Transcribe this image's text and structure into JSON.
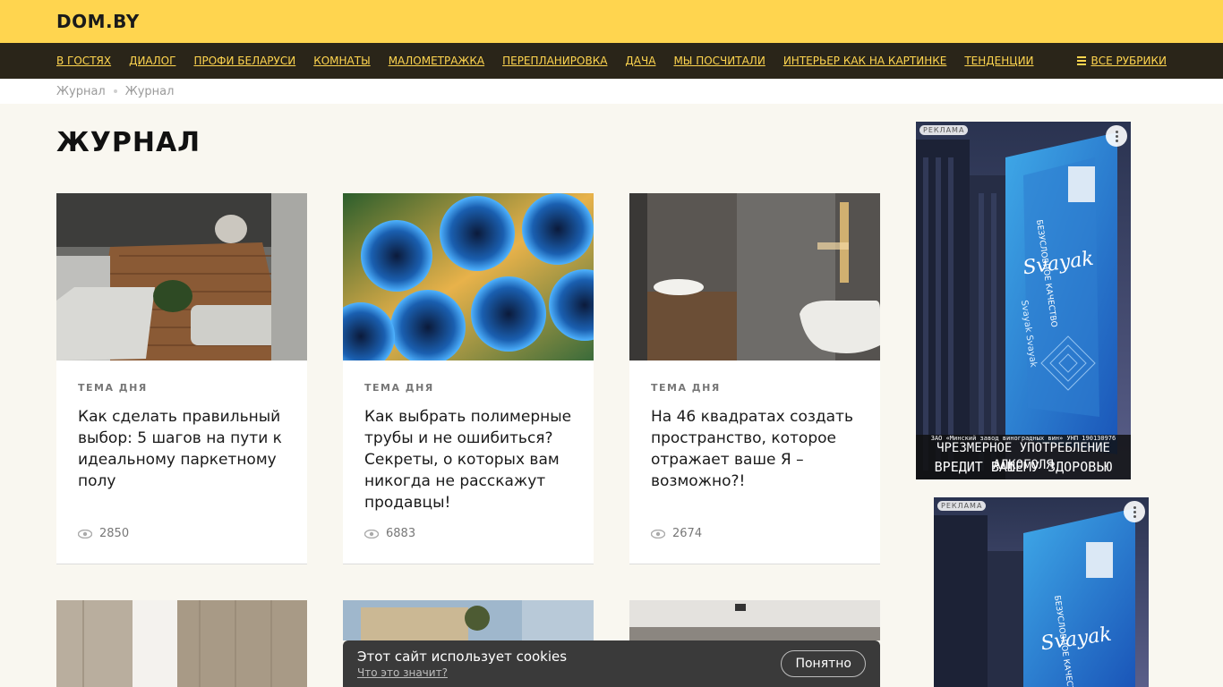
{
  "header": {
    "logo": "DOM.BY"
  },
  "nav": {
    "items": [
      "В ГОСТЯХ",
      "ДИАЛОГ",
      "ПРОФИ БЕЛАРУСИ",
      "КОМНАТЫ",
      "МАЛОМЕТРАЖКА",
      "ПЕРЕПЛАНИРОВКА",
      "ДАЧА",
      "МЫ ПОСЧИТАЛИ",
      "ИНТЕРЬЕР КАК НА КАРТИНКЕ",
      "ТЕНДЕНЦИИ"
    ],
    "all_rubrics": "ВСЕ РУБРИКИ",
    "accent": "#ffd54f",
    "background": "#2a2519"
  },
  "breadcrumbs": [
    "Журнал",
    "Журнал"
  ],
  "page_title": "ЖУРНАЛ",
  "cards": [
    {
      "tag": "ТЕМА ДНЯ",
      "title": "Как сделать правильный выбор: 5 шагов на пути к идеальному паркетному полу",
      "views": "2850",
      "image": "living-room-parquet"
    },
    {
      "tag": "ТЕМА ДНЯ",
      "title": "Как выбрать полимерные трубы и не ошибиться? Секреты, о которых вам никогда не расскажут продавцы!",
      "views": "6883",
      "image": "blue-pipes"
    },
    {
      "tag": "ТЕМА ДНЯ",
      "title": "На 46 квадратах создать пространство, которое отражает ваше Я – возможно?!",
      "views": "2674",
      "image": "bathroom"
    }
  ],
  "ads": [
    {
      "label": "РЕКЛАМА",
      "brand": "Svayak",
      "slogan": "БЕЗУСЛОВНОЕ КАЧЕСТВО",
      "legal": "ЗАО «Минский завод виноградных вин» УНП 190130976",
      "warning_line1": "ЧРЕЗМЕРНОЕ УПОТРЕБЛЕНИЕ АЛКОГОЛЯ",
      "warning_line2": "ВРЕДИТ ВАШЕМУ ЗДОРОВЬЮ"
    },
    {
      "label": "РЕКЛАМА",
      "brand": "Svayak",
      "slogan": "БЕЗУСЛОВНОЕ КАЧЕСТВО"
    }
  ],
  "cookie": {
    "text": "Этот сайт использует cookies",
    "link": "Что это значит?",
    "button": "Понятно"
  }
}
